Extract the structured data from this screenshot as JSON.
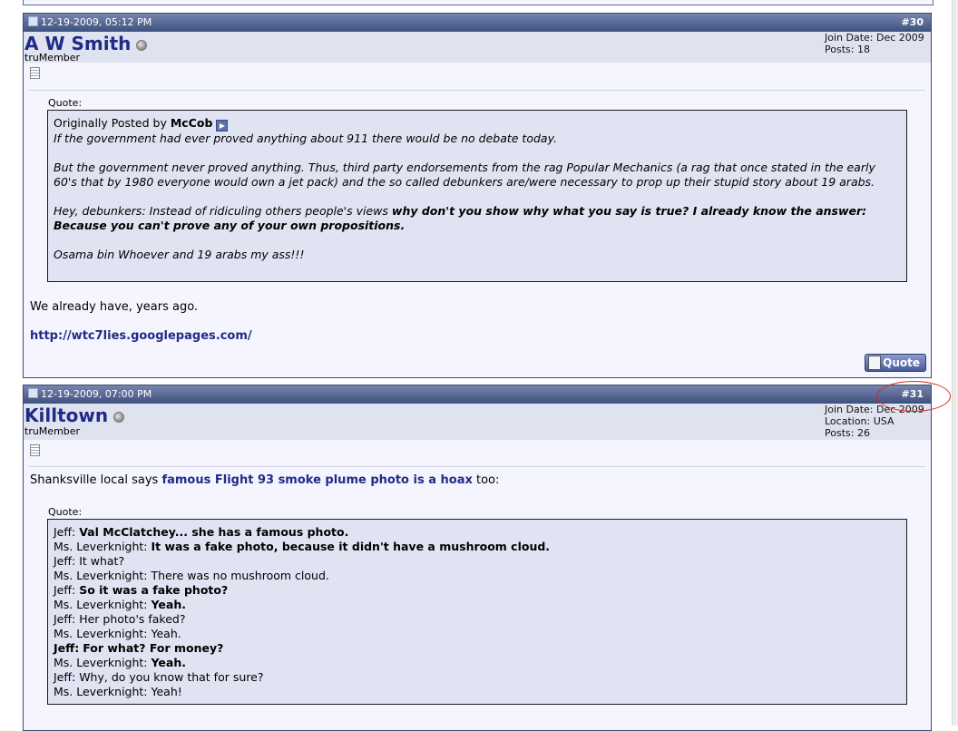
{
  "posts": [
    {
      "date": "12-19-2009, 05:12 PM",
      "number": "#30",
      "username": "A W Smith",
      "user_title": "truMember",
      "info": [
        "Join Date: Dec 2009",
        "Posts: 18"
      ],
      "quote_label": "Quote:",
      "quote": {
        "origin_prefix": "Originally Posted by",
        "origin_user": "McCob",
        "p1": "If the government had ever proved anything about 911 there would be no debate today.",
        "p2": "But the government never proved anything. Thus, third party endorsements from the rag Popular Mechanics (a rag that once stated in the early 60's that by 1980 everyone would own a jet pack) and the so called debunkers are/were necessary to prop up their stupid story about 19 arabs.",
        "p3_normal": "Hey, debunkers: Instead of ridiculing others people's views",
        "p3_bold": "why don't you show why what you say is true? I already know the answer: Because you can't prove any of your own propositions.",
        "p4": "Osama bin Whoever and 19 arabs my ass!!!"
      },
      "text": "We already have, years ago.",
      "link": "http://wtc7lies.googlepages.com/",
      "quote_button": "Quote"
    },
    {
      "date": "12-19-2009, 07:00 PM",
      "number": "#31",
      "username": "Killtown",
      "user_title": "truMember",
      "info": [
        "Join Date: Dec 2009",
        "Location: USA",
        "Posts: 26"
      ],
      "text_before": "Shanksville local says",
      "link": "famous Flight 93 smoke plume photo is a hoax",
      "text_after": "too:",
      "quote_label": "Quote:",
      "dialogue": [
        {
          "speaker": "Jeff:",
          "line": "Val McClatchey... she has a famous photo.",
          "bold": true
        },
        {
          "speaker": "Ms. Leverknight:",
          "line": "It was a fake photo, because it didn't have a mushroom cloud.",
          "bold": true
        },
        {
          "speaker": "Jeff:",
          "line": "It what?",
          "bold": false
        },
        {
          "speaker": "Ms. Leverknight:",
          "line": "There was no mushroom cloud.",
          "bold": false
        },
        {
          "speaker": "Jeff:",
          "line": "So it was a fake photo?",
          "bold": true
        },
        {
          "speaker": "Ms. Leverknight:",
          "line": "Yeah.",
          "bold": true
        },
        {
          "speaker": "Jeff:",
          "line": "Her photo's faked?",
          "bold": false
        },
        {
          "speaker": "Ms. Leverknight:",
          "line": "Yeah.",
          "bold": false
        },
        {
          "speaker": "Jeff:",
          "line": "For what? For money?",
          "bold": true,
          "speaker_bold": true
        },
        {
          "speaker": "Ms. Leverknight:",
          "line": "Yeah.",
          "bold": true
        },
        {
          "speaker": "Jeff:",
          "line": "Why, do you know that for sure?",
          "bold": false
        },
        {
          "speaker": "Ms. Leverknight:",
          "line": "Yeah!",
          "bold": false
        }
      ]
    }
  ],
  "colors": {
    "header_dark": "#3e507f",
    "header_light": "#7686ad",
    "username": "#1f2b86",
    "quote_bg": "#e0e4f2",
    "annotation": "#e0261c"
  }
}
